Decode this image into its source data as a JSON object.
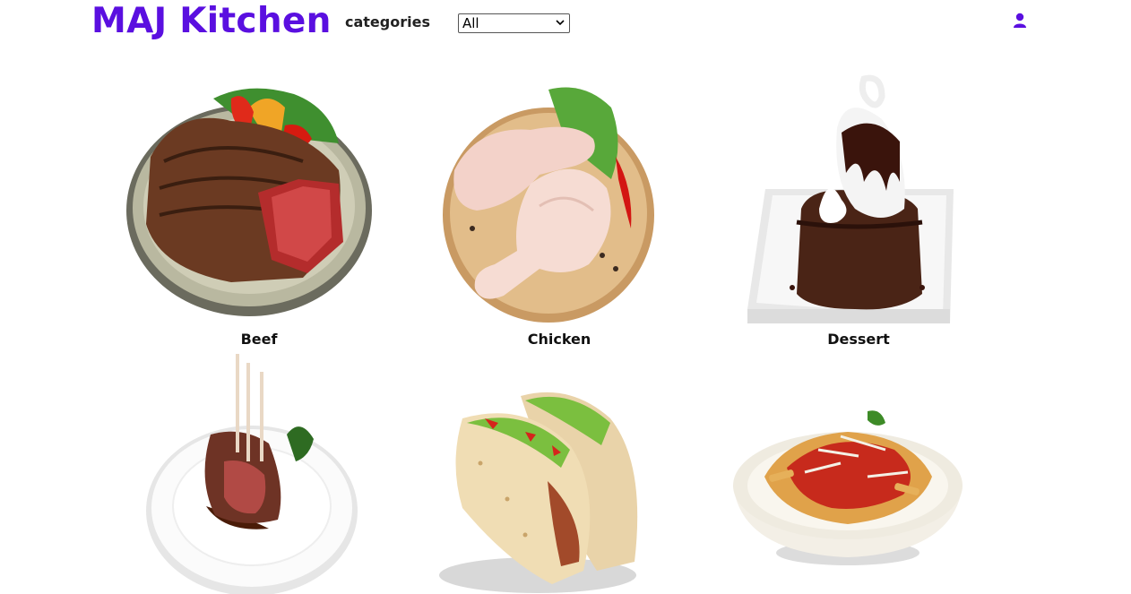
{
  "header": {
    "brand": "MAJ Kitchen",
    "categories_label": "categories",
    "select_value": "All",
    "user_icon": "user-icon"
  },
  "categories": [
    {
      "name": "Beef",
      "icon": "beef-steak-image"
    },
    {
      "name": "Chicken",
      "icon": "chicken-legs-image"
    },
    {
      "name": "Dessert",
      "icon": "lava-cake-image"
    },
    {
      "name": "",
      "icon": "lamb-chops-image"
    },
    {
      "name": "",
      "icon": "tacos-image"
    },
    {
      "name": "",
      "icon": "pasta-image"
    }
  ],
  "colors": {
    "brand": "#5a0fe0",
    "icon": "#5a0fe0"
  }
}
